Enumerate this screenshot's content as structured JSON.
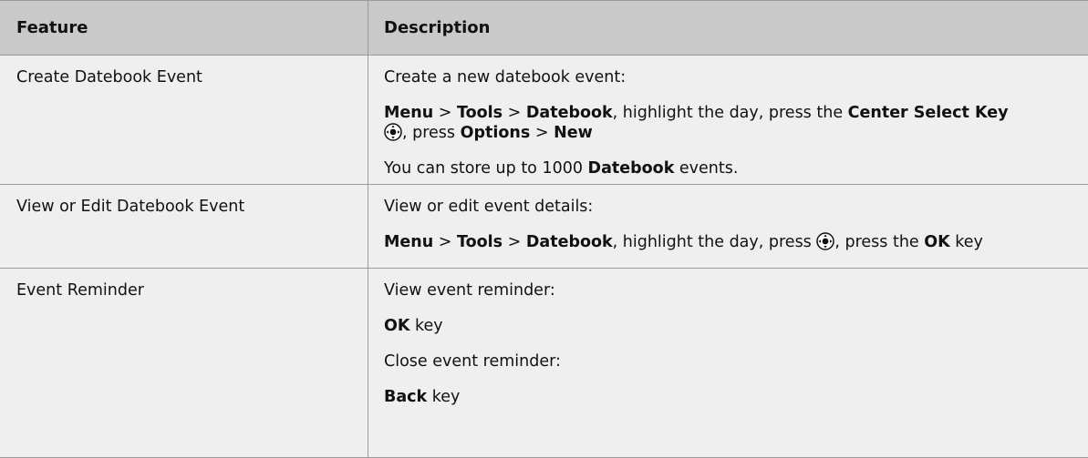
{
  "table": {
    "headers": {
      "feature": "Feature",
      "description": "Description"
    },
    "rows": [
      {
        "feature": "Create Datebook Event",
        "intro": "Create a new datebook event:",
        "path": {
          "menu": "Menu",
          "sep1": " > ",
          "tools": "Tools",
          "sep2": " > ",
          "datebook": "Datebook",
          "text1": ", highlight the day, press the ",
          "key": "Center Select Key",
          "text2": ", press ",
          "options": "Options",
          "sep3": " > ",
          "new": "New"
        },
        "note_pre": "You can store up to 1000 ",
        "note_bold": "Datebook",
        "note_post": " events."
      },
      {
        "feature": "View or Edit Datebook Event",
        "intro": "View or edit event details:",
        "path": {
          "menu": "Menu",
          "sep1": " > ",
          "tools": "Tools",
          "sep2": " > ",
          "datebook": "Datebook",
          "text1": ", highlight the day, press ",
          "text2": ", press the ",
          "ok": "OK",
          "text3": " key"
        }
      },
      {
        "feature": "Event Reminder",
        "view_intro": "View event reminder:",
        "view_key_bold": "OK",
        "view_key_text": " key",
        "close_intro": "Close event reminder:",
        "close_key_bold": "Back",
        "close_key_text": " key"
      }
    ]
  },
  "icons": {
    "nav_key": "center-select-key-icon"
  }
}
